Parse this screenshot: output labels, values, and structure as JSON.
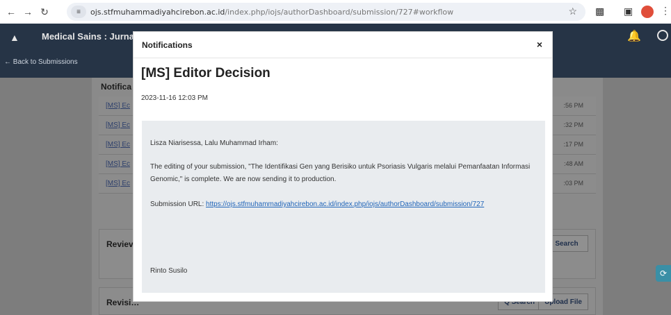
{
  "browser": {
    "url_host": "ojs.stfmuhammadiyahcirebon.ac.id",
    "url_path": "/index.php/iojs/authorDashboard/submission/727#workflow"
  },
  "app": {
    "title": "Medical Sains : Jurnal",
    "back_link": "← Back to Submissions",
    "notifications_heading": "Notifica",
    "notifications": [
      {
        "subject": "[MS] Ec",
        "time": ":56 PM"
      },
      {
        "subject": "[MS] Ec",
        "time": ":32 PM"
      },
      {
        "subject": "[MS] Ec",
        "time": ":17 PM"
      },
      {
        "subject": "[MS] Ec",
        "time": ":48 AM"
      },
      {
        "subject": "[MS] Ec",
        "time": ":03 PM"
      }
    ],
    "review_label": "Reviev",
    "review_search": "Search",
    "revisions_label": "Revisi…",
    "revisions_search": "Q Search",
    "revisions_upload": "Upload File"
  },
  "modal": {
    "header": "Notifications",
    "close": "×",
    "subject": "[MS] Editor Decision",
    "date": "2023-11-16 12:03 PM",
    "greeting": "Lisza Niarisessa, Lalu Muhammad Irham:",
    "body": "The editing of your submission, \"The Identifikasi Gen yang Berisiko untuk Psoriasis Vulgaris melalui Pemanfaatan Informasi Genomic,\" is complete. We are now sending it to production.",
    "url_label": "Submission URL:",
    "url": "https://ojs.stfmuhammadiyahcirebon.ac.id/index.php/iojs/authorDashboard/submission/727",
    "signature": "Rinto Susilo"
  }
}
